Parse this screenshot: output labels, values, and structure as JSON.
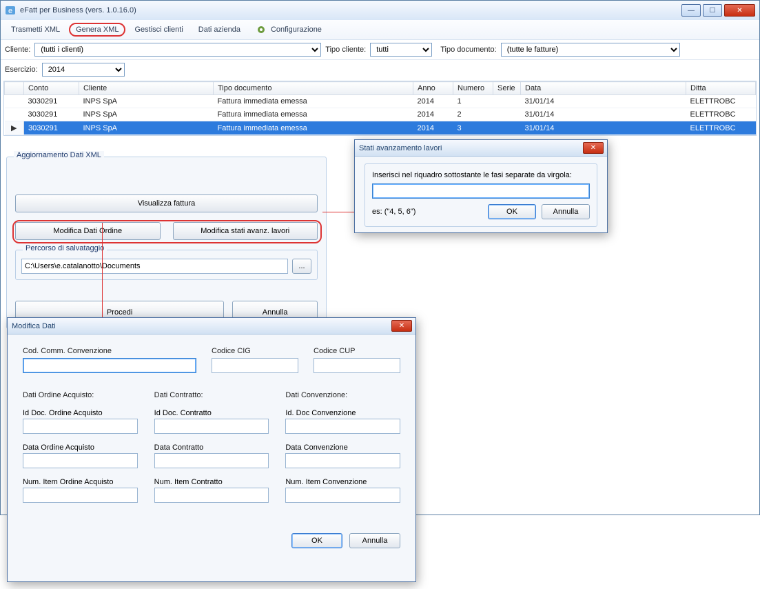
{
  "window": {
    "title": "eFatt per Business (vers. 1.0.16.0)"
  },
  "winbtns": {
    "min": "—",
    "max": "☐",
    "close": "✕"
  },
  "toolbar": {
    "trasmetti": "Trasmetti XML",
    "genera": "Genera XML",
    "clienti": "Gestisci clienti",
    "azienda": "Dati azienda",
    "config": "Configurazione"
  },
  "filters": {
    "cliente_label": "Cliente:",
    "cliente_value": "(tutti i clienti)",
    "tipocliente_label": "Tipo cliente:",
    "tipocliente_value": "tutti",
    "tipodoc_label": "Tipo documento:",
    "tipodoc_value": "(tutte le fatture)",
    "esercizio_label": "Esercizio:",
    "esercizio_value": "2014"
  },
  "grid": {
    "headers": {
      "conto": "Conto",
      "cliente": "Cliente",
      "tipodoc": "Tipo documento",
      "anno": "Anno",
      "numero": "Numero",
      "serie": "Serie",
      "data": "Data",
      "ditta": "Ditta"
    },
    "rows": [
      {
        "conto": "3030291",
        "cliente": "INPS SpA",
        "tipodoc": "Fattura immediata emessa",
        "anno": "2014",
        "numero": "1",
        "serie": "",
        "data": "31/01/14",
        "ditta": "ELETTROBC"
      },
      {
        "conto": "3030291",
        "cliente": "INPS SpA",
        "tipodoc": "Fattura immediata emessa",
        "anno": "2014",
        "numero": "2",
        "serie": "",
        "data": "31/01/14",
        "ditta": "ELETTROBC"
      },
      {
        "conto": "3030291",
        "cliente": "INPS SpA",
        "tipodoc": "Fattura immediata emessa",
        "anno": "2014",
        "numero": "3",
        "serie": "",
        "data": "31/01/14",
        "ditta": "ELETTROBC"
      }
    ],
    "pointer": "▶"
  },
  "xmlbox": {
    "title": "Aggiornamento Dati XML",
    "visualizza": "Visualizza fattura",
    "modifica_ordine": "Modifica Dati Ordine",
    "modifica_stati": "Modifica stati avanz. lavori",
    "percorso_legend": "Percorso di salvataggio",
    "percorso_value": "C:\\Users\\e.catalanotto\\Documents",
    "browse": "...",
    "procedi": "Procedi",
    "annulla": "Annulla"
  },
  "stati": {
    "title": "Stati avanzamento lavori",
    "instr": "Inserisci nel riquadro sottostante le fasi separate da virgola:",
    "example": "es: (\"4, 5, 6\")",
    "ok": "OK",
    "annulla": "Annulla"
  },
  "modifica": {
    "title": "Modifica Dati",
    "cod_conv": "Cod. Comm. Convenzione",
    "cig": "Codice CIG",
    "cup": "Codice CUP",
    "ordine_head": "Dati Ordine Acquisto:",
    "contratto_head": "Dati Contratto:",
    "convenzione_head": "Dati Convenzione:",
    "ordine": {
      "id": "Id Doc. Ordine Acquisto",
      "data": "Data Ordine Acquisto",
      "num": "Num. Item Ordine Acquisto"
    },
    "contratto": {
      "id": "Id Doc. Contratto",
      "data": "Data Contratto",
      "num": "Num. Item Contratto"
    },
    "convenzione": {
      "id": "Id. Doc Convenzione",
      "data": "Data Convenzione",
      "num": "Num. Item Convenzione"
    },
    "ok": "OK",
    "annulla": "Annulla"
  }
}
